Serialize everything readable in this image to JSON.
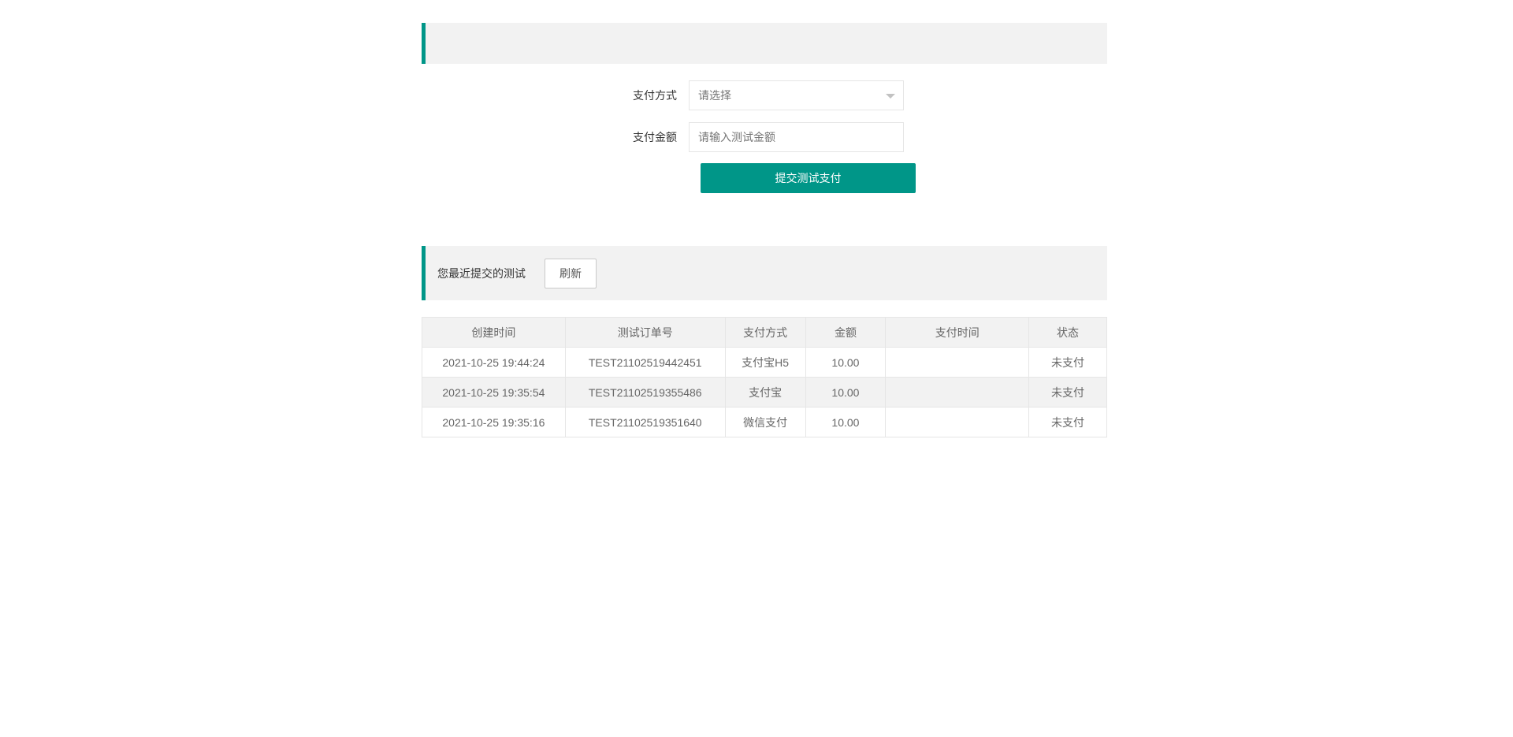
{
  "form": {
    "pay_method_label": "支付方式",
    "pay_method_value": "请选择",
    "amount_label": "支付金额",
    "amount_placeholder": "请输入测试金额",
    "submit_label": "提交测试支付"
  },
  "recent": {
    "title": "您最近提交的测试",
    "refresh_label": "刷新"
  },
  "table": {
    "headers": [
      "创建时间",
      "测试订单号",
      "支付方式",
      "金额",
      "支付时间",
      "状态"
    ],
    "rows": [
      [
        "2021-10-25 19:44:24",
        "TEST21102519442451",
        "支付宝H5",
        "10.00",
        "",
        "未支付"
      ],
      [
        "2021-10-25 19:35:54",
        "TEST21102519355486",
        "支付宝",
        "10.00",
        "",
        "未支付"
      ],
      [
        "2021-10-25 19:35:16",
        "TEST21102519351640",
        "微信支付",
        "10.00",
        "",
        "未支付"
      ]
    ]
  },
  "colors": {
    "accent": "#009688",
    "header_bg": "#f2f2f2",
    "border": "#e6e6e6"
  },
  "icons": {
    "select_caret": "caret-down-icon"
  }
}
